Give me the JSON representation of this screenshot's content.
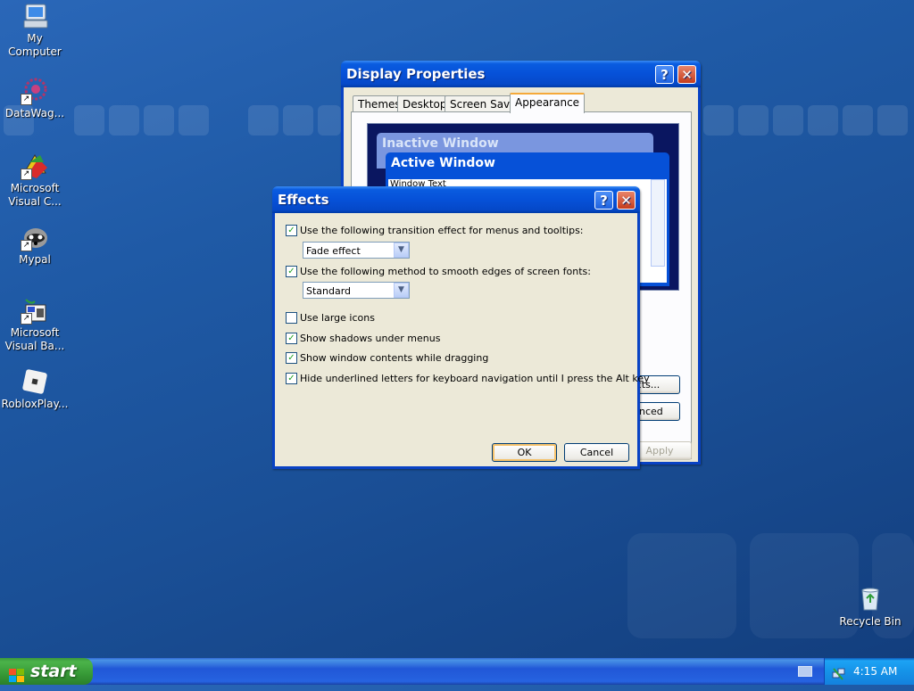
{
  "desktop": {
    "icons": [
      {
        "label_line1": "My",
        "label_line2": "Computer",
        "icon": "computer-icon"
      },
      {
        "label_line1": "DataWag...",
        "label_line2": "",
        "icon": "datawag-icon"
      },
      {
        "label_line1": "Microsoft",
        "label_line2": "Visual C...",
        "icon": "visual-c-icon"
      },
      {
        "label_line1": "Mypal",
        "label_line2": "",
        "icon": "mypal-icon"
      },
      {
        "label_line1": "Microsoft",
        "label_line2": "Visual Ba...",
        "icon": "visual-basic-icon"
      },
      {
        "label_line1": "RobloxPlay...",
        "label_line2": "",
        "icon": "roblox-icon"
      },
      {
        "label_line1": "Recycle Bin",
        "label_line2": "",
        "icon": "recycle-bin-icon"
      }
    ]
  },
  "display_properties": {
    "title": "Display Properties",
    "help_glyph": "?",
    "close_glyph": "✕",
    "tabs": [
      "Themes",
      "Desktop",
      "Screen Saver",
      "Appearance"
    ],
    "active_tab": "Appearance",
    "preview": {
      "inactive_title": "Inactive Window",
      "active_title": "Active Window",
      "window_text": "Window Text"
    },
    "buttons": {
      "effects": "cts...",
      "advanced": "anced",
      "apply": "Apply"
    }
  },
  "effects": {
    "title": "Effects",
    "help_glyph": "?",
    "close_glyph": "✕",
    "options": [
      {
        "label": "Use the following transition effect for menus and tooltips:",
        "checked": true
      },
      {
        "label": "Use the following method to smooth edges of screen fonts:",
        "checked": true
      },
      {
        "label": "Use large icons",
        "checked": false
      },
      {
        "label": "Show shadows under menus",
        "checked": true
      },
      {
        "label": "Show window contents while dragging",
        "checked": true
      },
      {
        "label": "Hide underlined letters for keyboard navigation until I press the Alt key",
        "checked": true
      }
    ],
    "transition_value": "Fade effect",
    "smoothing_value": "Standard",
    "ok_label": "OK",
    "cancel_label": "Cancel",
    "check_glyph": "✓"
  },
  "taskbar": {
    "start_label": "start",
    "clock": "4:15 AM"
  },
  "colors": {
    "desktop_blue": "#1f5aa6",
    "titlebar_blue": "#0651d8",
    "close_red": "#c63c1c",
    "dialog_face": "#ece9d8",
    "start_green": "#379a37",
    "preview_navy": "#0a1660"
  }
}
